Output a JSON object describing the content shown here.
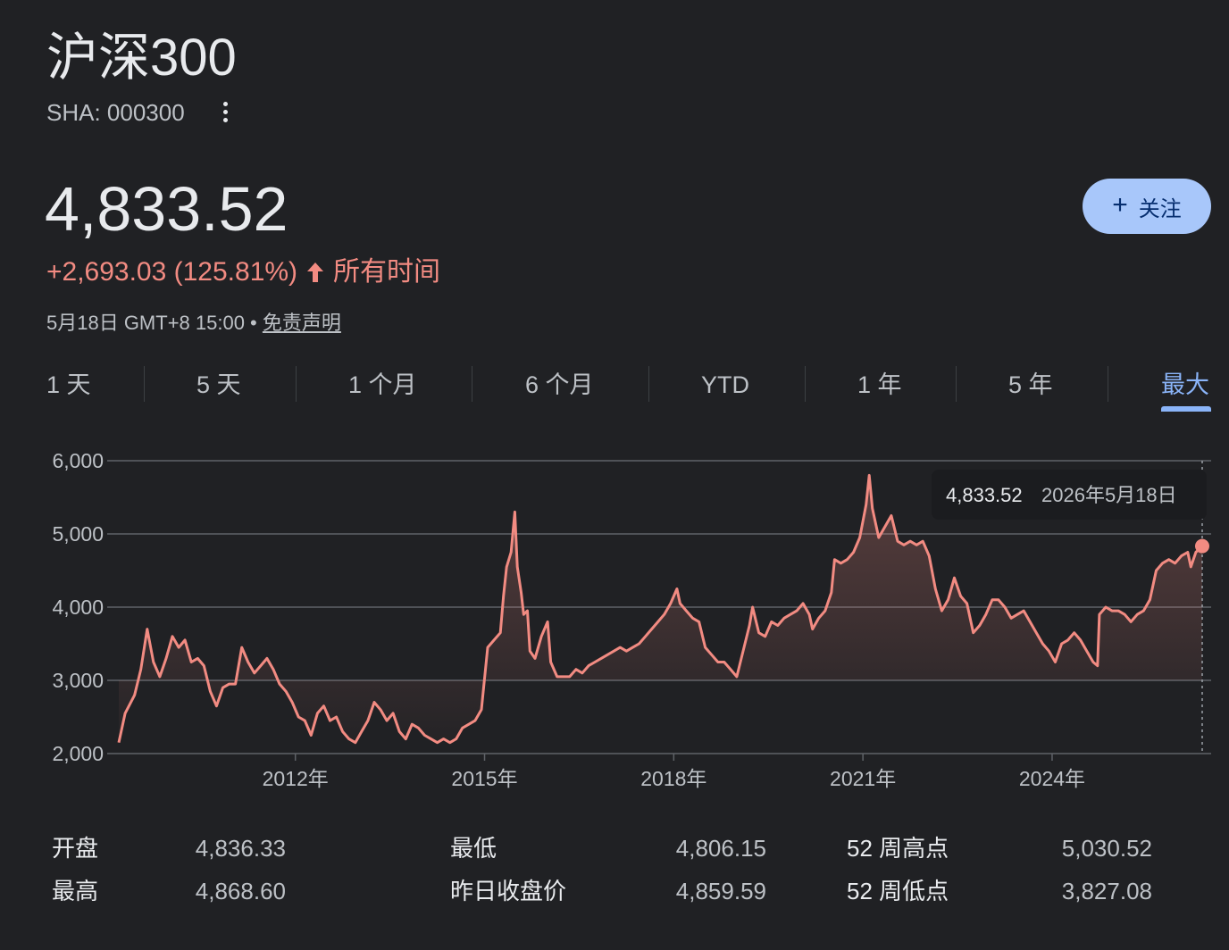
{
  "header": {
    "title": "沪深300",
    "ticker": "SHA: 000300",
    "more_icon": "more-vert-icon"
  },
  "quote": {
    "price": "4,833.52",
    "change": "+2,693.03 (125.81%)",
    "period": "所有时间",
    "timestamp": "5月18日 GMT+8 15:00 • ",
    "disclaimer": "免责声明",
    "change_color": "#f28b82"
  },
  "follow_button": {
    "label": "关注",
    "icon": "plus-icon",
    "color": "#a8c7fa"
  },
  "tabs": [
    {
      "label": "1 天"
    },
    {
      "label": "5 天"
    },
    {
      "label": "1 个月"
    },
    {
      "label": "6 个月"
    },
    {
      "label": "YTD"
    },
    {
      "label": "1 年"
    },
    {
      "label": "5 年"
    },
    {
      "label": "最大",
      "active": true
    }
  ],
  "chart_data": {
    "type": "area",
    "y_ticks": [
      "6,000",
      "5,000",
      "4,000",
      "3,000",
      "2,000"
    ],
    "x_ticks": [
      "2012年",
      "2015年",
      "2018年",
      "2021年",
      "2024年"
    ],
    "ylim": [
      2000,
      6000
    ],
    "x_range": [
      2009.2,
      2026.38
    ],
    "x_tick_values": [
      2012,
      2015,
      2018,
      2021,
      2024
    ],
    "line_color": "#f28b82",
    "grid": true,
    "tooltip": {
      "value": "4,833.52",
      "date": "2026年5月18日"
    },
    "points": [
      [
        2009.2,
        2150
      ],
      [
        2009.3,
        2550
      ],
      [
        2009.45,
        2800
      ],
      [
        2009.55,
        3150
      ],
      [
        2009.65,
        3700
      ],
      [
        2009.75,
        3250
      ],
      [
        2009.85,
        3050
      ],
      [
        2009.95,
        3300
      ],
      [
        2010.05,
        3600
      ],
      [
        2010.15,
        3450
      ],
      [
        2010.25,
        3550
      ],
      [
        2010.35,
        3250
      ],
      [
        2010.45,
        3300
      ],
      [
        2010.55,
        3200
      ],
      [
        2010.65,
        2850
      ],
      [
        2010.75,
        2650
      ],
      [
        2010.85,
        2900
      ],
      [
        2010.95,
        2950
      ],
      [
        2011.05,
        2950
      ],
      [
        2011.15,
        3450
      ],
      [
        2011.25,
        3250
      ],
      [
        2011.35,
        3100
      ],
      [
        2011.45,
        3200
      ],
      [
        2011.55,
        3300
      ],
      [
        2011.65,
        3150
      ],
      [
        2011.75,
        2950
      ],
      [
        2011.85,
        2850
      ],
      [
        2011.95,
        2700
      ],
      [
        2012.05,
        2500
      ],
      [
        2012.15,
        2450
      ],
      [
        2012.25,
        2250
      ],
      [
        2012.35,
        2550
      ],
      [
        2012.45,
        2650
      ],
      [
        2012.55,
        2450
      ],
      [
        2012.65,
        2500
      ],
      [
        2012.75,
        2300
      ],
      [
        2012.85,
        2200
      ],
      [
        2012.95,
        2150
      ],
      [
        2013.05,
        2300
      ],
      [
        2013.15,
        2450
      ],
      [
        2013.25,
        2700
      ],
      [
        2013.35,
        2600
      ],
      [
        2013.45,
        2450
      ],
      [
        2013.55,
        2550
      ],
      [
        2013.65,
        2300
      ],
      [
        2013.75,
        2200
      ],
      [
        2013.85,
        2400
      ],
      [
        2013.95,
        2350
      ],
      [
        2014.05,
        2250
      ],
      [
        2014.15,
        2200
      ],
      [
        2014.25,
        2150
      ],
      [
        2014.35,
        2200
      ],
      [
        2014.45,
        2150
      ],
      [
        2014.55,
        2200
      ],
      [
        2014.65,
        2350
      ],
      [
        2014.75,
        2400
      ],
      [
        2014.85,
        2450
      ],
      [
        2014.95,
        2600
      ],
      [
        2015.05,
        3450
      ],
      [
        2015.15,
        3550
      ],
      [
        2015.25,
        3650
      ],
      [
        2015.3,
        4150
      ],
      [
        2015.35,
        4550
      ],
      [
        2015.42,
        4750
      ],
      [
        2015.48,
        5300
      ],
      [
        2015.52,
        4550
      ],
      [
        2015.58,
        4200
      ],
      [
        2015.62,
        3900
      ],
      [
        2015.68,
        3950
      ],
      [
        2015.72,
        3400
      ],
      [
        2015.8,
        3300
      ],
      [
        2015.9,
        3600
      ],
      [
        2016.0,
        3800
      ],
      [
        2016.05,
        3250
      ],
      [
        2016.15,
        3050
      ],
      [
        2016.25,
        3050
      ],
      [
        2016.35,
        3050
      ],
      [
        2016.45,
        3150
      ],
      [
        2016.55,
        3100
      ],
      [
        2016.65,
        3200
      ],
      [
        2016.75,
        3250
      ],
      [
        2016.85,
        3300
      ],
      [
        2016.95,
        3350
      ],
      [
        2017.05,
        3400
      ],
      [
        2017.15,
        3450
      ],
      [
        2017.25,
        3400
      ],
      [
        2017.35,
        3450
      ],
      [
        2017.45,
        3500
      ],
      [
        2017.55,
        3600
      ],
      [
        2017.65,
        3700
      ],
      [
        2017.75,
        3800
      ],
      [
        2017.85,
        3900
      ],
      [
        2017.95,
        4050
      ],
      [
        2018.05,
        4250
      ],
      [
        2018.1,
        4050
      ],
      [
        2018.2,
        3950
      ],
      [
        2018.3,
        3850
      ],
      [
        2018.4,
        3800
      ],
      [
        2018.5,
        3450
      ],
      [
        2018.6,
        3350
      ],
      [
        2018.7,
        3250
      ],
      [
        2018.8,
        3250
      ],
      [
        2018.9,
        3150
      ],
      [
        2019.0,
        3050
      ],
      [
        2019.1,
        3400
      ],
      [
        2019.2,
        3750
      ],
      [
        2019.25,
        4000
      ],
      [
        2019.35,
        3650
      ],
      [
        2019.45,
        3600
      ],
      [
        2019.55,
        3800
      ],
      [
        2019.65,
        3750
      ],
      [
        2019.75,
        3850
      ],
      [
        2019.85,
        3900
      ],
      [
        2019.95,
        3950
      ],
      [
        2020.05,
        4050
      ],
      [
        2020.15,
        3900
      ],
      [
        2020.2,
        3700
      ],
      [
        2020.3,
        3850
      ],
      [
        2020.4,
        3950
      ],
      [
        2020.5,
        4200
      ],
      [
        2020.55,
        4650
      ],
      [
        2020.65,
        4600
      ],
      [
        2020.75,
        4650
      ],
      [
        2020.85,
        4750
      ],
      [
        2020.95,
        4950
      ],
      [
        2021.05,
        5400
      ],
      [
        2021.1,
        5800
      ],
      [
        2021.15,
        5350
      ],
      [
        2021.25,
        4950
      ],
      [
        2021.35,
        5100
      ],
      [
        2021.45,
        5250
      ],
      [
        2021.55,
        4900
      ],
      [
        2021.65,
        4850
      ],
      [
        2021.75,
        4900
      ],
      [
        2021.85,
        4850
      ],
      [
        2021.95,
        4900
      ],
      [
        2022.05,
        4700
      ],
      [
        2022.15,
        4250
      ],
      [
        2022.25,
        3950
      ],
      [
        2022.35,
        4100
      ],
      [
        2022.45,
        4400
      ],
      [
        2022.55,
        4150
      ],
      [
        2022.65,
        4050
      ],
      [
        2022.75,
        3650
      ],
      [
        2022.85,
        3750
      ],
      [
        2022.95,
        3900
      ],
      [
        2023.05,
        4100
      ],
      [
        2023.15,
        4100
      ],
      [
        2023.25,
        4000
      ],
      [
        2023.35,
        3850
      ],
      [
        2023.45,
        3900
      ],
      [
        2023.55,
        3950
      ],
      [
        2023.65,
        3800
      ],
      [
        2023.75,
        3650
      ],
      [
        2023.85,
        3500
      ],
      [
        2023.95,
        3400
      ],
      [
        2024.05,
        3250
      ],
      [
        2024.15,
        3500
      ],
      [
        2024.25,
        3550
      ],
      [
        2024.35,
        3650
      ],
      [
        2024.45,
        3550
      ],
      [
        2024.55,
        3400
      ],
      [
        2024.65,
        3250
      ],
      [
        2024.72,
        3200
      ],
      [
        2024.75,
        3900
      ],
      [
        2024.85,
        4000
      ],
      [
        2024.95,
        3950
      ],
      [
        2025.05,
        3950
      ],
      [
        2025.15,
        3900
      ],
      [
        2025.25,
        3800
      ],
      [
        2025.35,
        3900
      ],
      [
        2025.45,
        3950
      ],
      [
        2025.55,
        4100
      ],
      [
        2025.65,
        4500
      ],
      [
        2025.75,
        4600
      ],
      [
        2025.85,
        4650
      ],
      [
        2025.95,
        4600
      ],
      [
        2026.05,
        4700
      ],
      [
        2026.15,
        4750
      ],
      [
        2026.2,
        4550
      ],
      [
        2026.28,
        4750
      ],
      [
        2026.38,
        4833.52
      ]
    ]
  },
  "stats": {
    "col1": [
      {
        "label": "开盘",
        "value": "4,836.33"
      },
      {
        "label": "最高",
        "value": "4,868.60"
      }
    ],
    "col2": [
      {
        "label": "最低",
        "value": "4,806.15"
      },
      {
        "label": "昨日收盘价",
        "value": "4,859.59"
      }
    ],
    "col3": [
      {
        "label": "52 周高点",
        "value": "5,030.52"
      },
      {
        "label": "52 周低点",
        "value": "3,827.08"
      }
    ]
  }
}
